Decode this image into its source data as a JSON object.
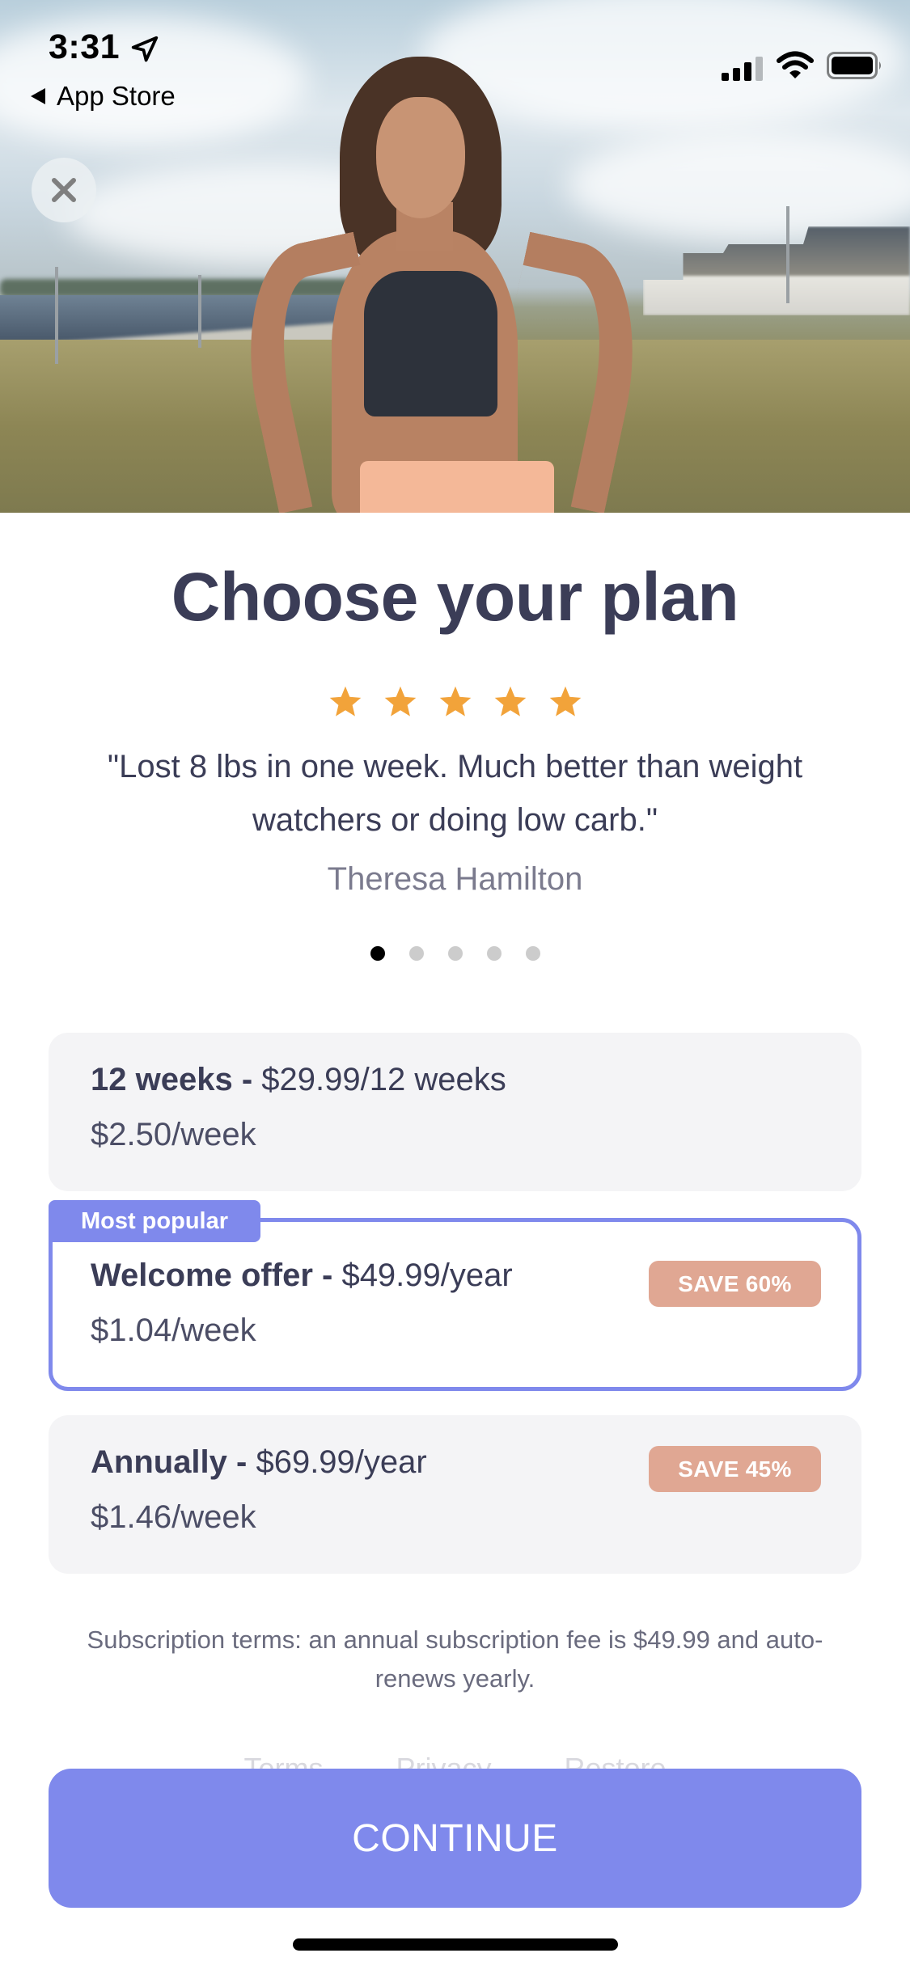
{
  "status_bar": {
    "time": "3:31",
    "back_label": "App Store",
    "signal_bars_active": 3,
    "signal_bars_total": 4,
    "battery_level": 1.0
  },
  "hero": {
    "image_description": "Smiling woman in black sports bra and peach shorts standing on grass by a waterfront"
  },
  "close_button": {
    "icon": "close-icon"
  },
  "title": "Choose your plan",
  "rating": {
    "stars": 5,
    "max": 5,
    "star_color": "#F2A33A"
  },
  "testimonial": {
    "quote": "\"Lost 8 lbs in one week. Much better than weight watchers or doing low carb.\"",
    "author": "Theresa Hamilton"
  },
  "carousel": {
    "page_count": 5,
    "active_index": 0
  },
  "plans": [
    {
      "name": "12 weeks -",
      "price": " $29.99/12 weeks",
      "weekly": "$2.50/week",
      "badge": null,
      "selected": false
    },
    {
      "tag": "Most popular",
      "name": "Welcome offer -",
      "price": " $49.99/year",
      "weekly": "$1.04/week",
      "badge": "SAVE 60%",
      "selected": true
    },
    {
      "name": "Annually -",
      "price": " $69.99/year",
      "weekly": "$1.46/week",
      "badge": "SAVE 45%",
      "selected": false
    }
  ],
  "subscription_terms": "Subscription terms: an annual subscription fee is $49.99 and auto-renews yearly.",
  "footer_links": [
    "Terms",
    "Privacy",
    "Restore"
  ],
  "continue_label": "CONTINUE",
  "colors": {
    "accent": "#7F89EC",
    "badge": "#E0A793",
    "text_primary": "#3B3D57",
    "text_secondary": "#7B7B8E",
    "card_bg": "#F4F4F6"
  }
}
